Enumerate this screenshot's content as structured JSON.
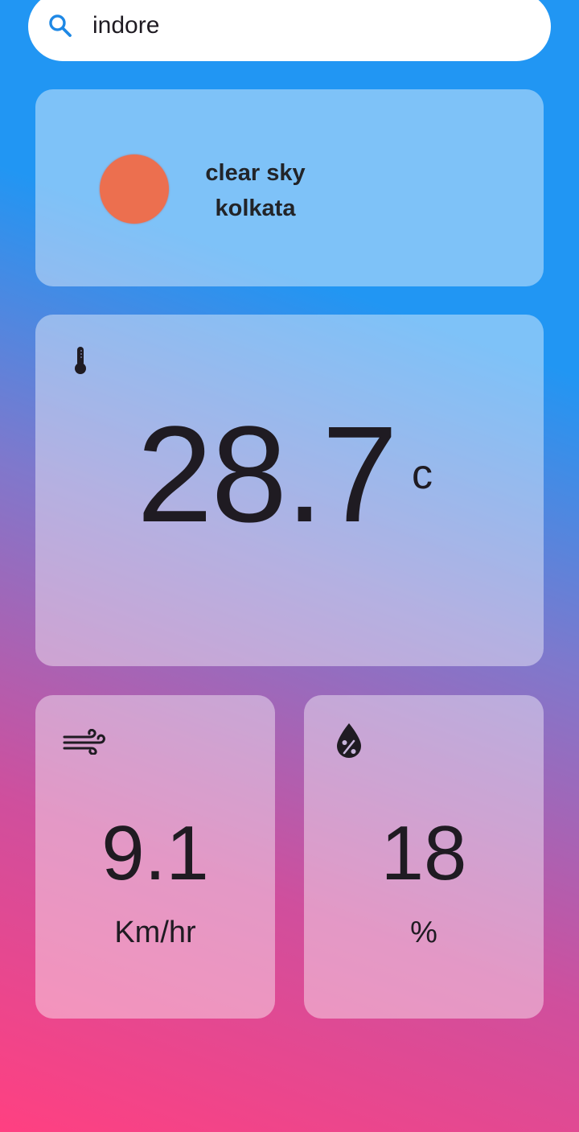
{
  "search": {
    "value": "indore",
    "icon": "search-icon",
    "accent_color": "#1e88e5"
  },
  "condition": {
    "description": "clear sky",
    "city": "kolkata",
    "sun_color": "#ec6f4f"
  },
  "temperature": {
    "value": "28.7",
    "unit": "c",
    "icon": "thermometer-icon"
  },
  "wind": {
    "value": "9.1",
    "unit": "Km/hr",
    "icon": "wind-icon"
  },
  "humidity": {
    "value": "18",
    "unit": "%",
    "icon": "humidity-icon"
  },
  "background": {
    "top_color": "#2196f3",
    "bottom_color": "#ff4081"
  }
}
